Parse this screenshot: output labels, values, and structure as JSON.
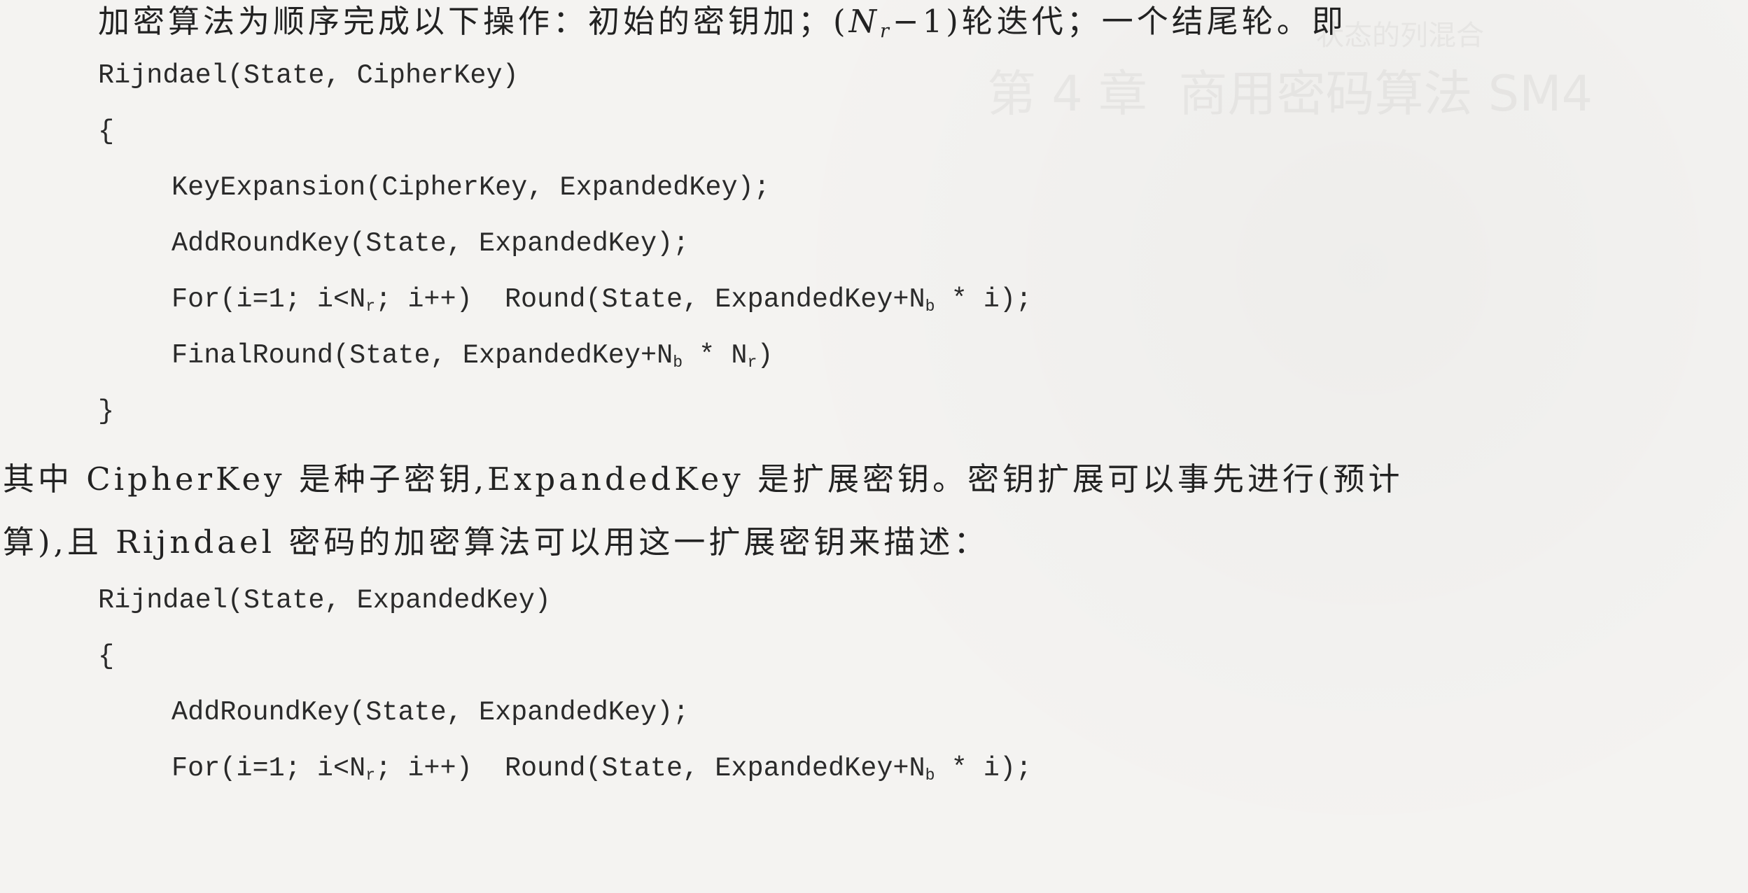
{
  "intro": {
    "before": "加密算法为顺序完成以下操作：初始的密钥加；(",
    "n": "N",
    "r": "r",
    "after": "−1)轮迭代；一个结尾轮。即"
  },
  "code1": {
    "l1": "Rijndael(State, CipherKey)",
    "l2": "{",
    "l3": "KeyExpansion(CipherKey, ExpandedKey);",
    "l4": "AddRoundKey(State, ExpandedKey);",
    "l5": {
      "a": "For(i=1; i<N",
      "b": "r",
      "c": "; i++)  Round(State, ExpandedKey+N",
      "d": "b",
      "e": " * i);"
    },
    "l6": {
      "a": "FinalRound(State, ExpandedKey+N",
      "b": "b",
      "c": " * N",
      "d": "r",
      "e": ")"
    },
    "l7": "}"
  },
  "para": {
    "l1": "其中 CipherKey 是种子密钥,ExpandedKey 是扩展密钥。密钥扩展可以事先进行(预计",
    "l2": "算),且 Rijndael 密码的加密算法可以用这一扩展密钥来描述："
  },
  "code2": {
    "l1": "Rijndael(State, ExpandedKey)",
    "l2": "{",
    "l3": "AddRoundKey(State, ExpandedKey);",
    "l4": {
      "a": "For(i=1; i<N",
      "b": "r",
      "c": "; i++)  Round(State, ExpandedKey+N",
      "d": "b",
      "e": " * i);"
    }
  }
}
